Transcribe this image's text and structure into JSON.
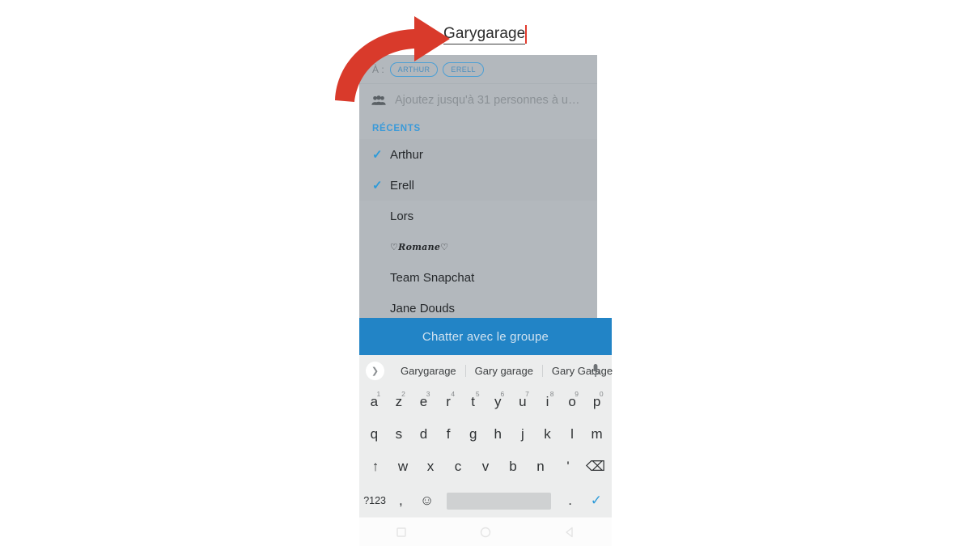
{
  "app": {
    "platform": "android",
    "accent_blue": "#2284c6",
    "check_blue": "#2e9bd9",
    "sheet_grey": "#b3b8bd",
    "annotation_red": "#d93a2b"
  },
  "title_field": {
    "value": "Garygarage",
    "caret_visible": true
  },
  "recipients": {
    "to_label": "À :",
    "chips": [
      "ARTHUR",
      "ERELL"
    ]
  },
  "add_people": {
    "icon": "group-people-icon",
    "text": "Ajoutez jusqu'à 31 personnes à u…"
  },
  "recents": {
    "header": "RÉCENTS",
    "contacts": [
      {
        "name": "Arthur",
        "selected": true
      },
      {
        "name": "Erell",
        "selected": true
      },
      {
        "name": "Lors",
        "selected": false
      },
      {
        "name": "♡Romane♡",
        "selected": false,
        "script": true
      },
      {
        "name": "Team Snapchat",
        "selected": false
      },
      {
        "name": "Jane Douds",
        "selected": false
      }
    ]
  },
  "cta": {
    "label": "Chatter avec le groupe"
  },
  "keyboard": {
    "expand_icon": "chevron-right-icon",
    "mic_icon": "microphone-icon",
    "suggestions": [
      "Garygarage",
      "Gary garage",
      "Gary Garage"
    ],
    "row1": [
      {
        "key": "a",
        "sup": "1"
      },
      {
        "key": "z",
        "sup": "2"
      },
      {
        "key": "e",
        "sup": "3"
      },
      {
        "key": "r",
        "sup": "4"
      },
      {
        "key": "t",
        "sup": "5"
      },
      {
        "key": "y",
        "sup": "6"
      },
      {
        "key": "u",
        "sup": "7"
      },
      {
        "key": "i",
        "sup": "8"
      },
      {
        "key": "o",
        "sup": "9"
      },
      {
        "key": "p",
        "sup": "0"
      }
    ],
    "row2": [
      "q",
      "s",
      "d",
      "f",
      "g",
      "h",
      "j",
      "k",
      "l",
      "m"
    ],
    "row3": [
      "↑",
      "w",
      "x",
      "c",
      "v",
      "b",
      "n",
      "'",
      "⌫"
    ],
    "row4": {
      "symbols": "?123",
      "comma": ",",
      "emoji": "☺",
      "space": "",
      "period": ".",
      "enter": "✓"
    }
  },
  "nav_bar": {
    "recents_icon": "square-icon",
    "home_icon": "circle-icon",
    "back_icon": "triangle-back-icon"
  },
  "annotation": {
    "arrow": "curved-red-arrow-pointing-to-title"
  }
}
